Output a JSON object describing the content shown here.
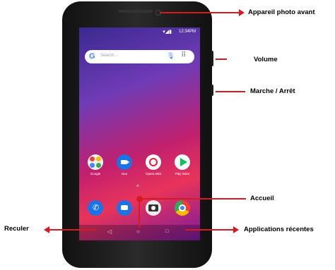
{
  "phone": {
    "status_time": "12:34PM",
    "search_placeholder": "Search...",
    "apps": [
      {
        "label": "Google",
        "color": "#ffffff"
      },
      {
        "label": "Duo",
        "color": "#1a73e8"
      },
      {
        "label": "Opera Mini",
        "color": "#ffffff"
      },
      {
        "label": "Play Store",
        "color": "#ffffff"
      }
    ],
    "dock_icons": [
      "phone-icon",
      "messages-icon",
      "camera-icon",
      "chrome-icon"
    ]
  },
  "callouts": {
    "front_camera": "Appareil photo avant",
    "volume": "Volume",
    "power": "Marche / Arrêt",
    "home": "Accueil",
    "back": "Reculer",
    "recent_apps": "Applications récentes"
  },
  "colors": {
    "callout": "#d71920",
    "wallpaper_purple": "#6f3bb6",
    "wallpaper_red": "#e8345a"
  }
}
